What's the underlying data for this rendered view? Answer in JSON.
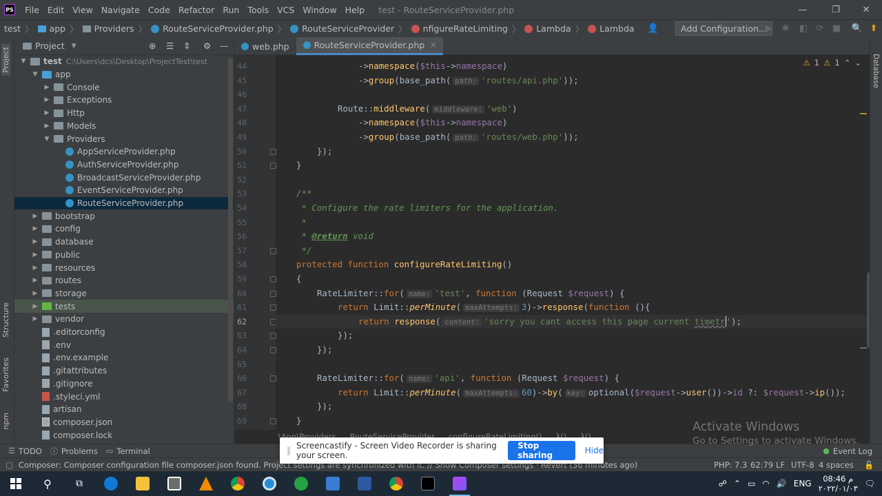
{
  "menubar": {
    "logo": "PS",
    "items": [
      "File",
      "Edit",
      "View",
      "Navigate",
      "Code",
      "Refactor",
      "Run",
      "Tools",
      "VCS",
      "Window",
      "Help"
    ],
    "title": "test - RouteServiceProvider.php"
  },
  "navbar": {
    "crumbs": [
      "test",
      "app",
      "Providers",
      "RouteServiceProvider.php",
      "RouteServiceProvider",
      "nfigureRateLimiting",
      "Lambda",
      "Lambda"
    ],
    "add_configuration": "Add Configuration..."
  },
  "left_strip": {
    "labels": [
      "Project",
      "Structure",
      "Favorites",
      "npm"
    ]
  },
  "project_panel": {
    "title": "Project",
    "tree": [
      {
        "label": "test",
        "path": "C:\\Users\\dcs\\Desktop\\ProjectTest\\test",
        "level": 0,
        "kind": "folder",
        "open": true
      },
      {
        "label": "app",
        "level": 1,
        "kind": "folder-blue",
        "open": true
      },
      {
        "label": "Console",
        "level": 2,
        "kind": "folder",
        "open": false
      },
      {
        "label": "Exceptions",
        "level": 2,
        "kind": "folder",
        "open": false
      },
      {
        "label": "Http",
        "level": 2,
        "kind": "folder",
        "open": false
      },
      {
        "label": "Models",
        "level": 2,
        "kind": "folder",
        "open": false
      },
      {
        "label": "Providers",
        "level": 2,
        "kind": "folder",
        "open": true
      },
      {
        "label": "AppServiceProvider.php",
        "level": 3,
        "kind": "php"
      },
      {
        "label": "AuthServiceProvider.php",
        "level": 3,
        "kind": "php"
      },
      {
        "label": "BroadcastServiceProvider.php",
        "level": 3,
        "kind": "php"
      },
      {
        "label": "EventServiceProvider.php",
        "level": 3,
        "kind": "php"
      },
      {
        "label": "RouteServiceProvider.php",
        "level": 3,
        "kind": "php",
        "selected": true
      },
      {
        "label": "bootstrap",
        "level": 1,
        "kind": "folder",
        "open": false
      },
      {
        "label": "config",
        "level": 1,
        "kind": "folder",
        "open": false
      },
      {
        "label": "database",
        "level": 1,
        "kind": "folder",
        "open": false
      },
      {
        "label": "public",
        "level": 1,
        "kind": "folder",
        "open": false
      },
      {
        "label": "resources",
        "level": 1,
        "kind": "folder",
        "open": false
      },
      {
        "label": "routes",
        "level": 1,
        "kind": "folder",
        "open": false
      },
      {
        "label": "storage",
        "level": 1,
        "kind": "folder",
        "open": false
      },
      {
        "label": "tests",
        "level": 1,
        "kind": "folder-green",
        "open": false,
        "highlight": true
      },
      {
        "label": "vendor",
        "level": 1,
        "kind": "folder",
        "open": false
      },
      {
        "label": ".editorconfig",
        "level": 1,
        "kind": "file"
      },
      {
        "label": ".env",
        "level": 1,
        "kind": "file"
      },
      {
        "label": ".env.example",
        "level": 1,
        "kind": "file"
      },
      {
        "label": ".gitattributes",
        "level": 1,
        "kind": "file"
      },
      {
        "label": ".gitignore",
        "level": 1,
        "kind": "file"
      },
      {
        "label": ".styleci.yml",
        "level": 1,
        "kind": "yml"
      },
      {
        "label": "artisan",
        "level": 1,
        "kind": "file"
      },
      {
        "label": "composer.json",
        "level": 1,
        "kind": "json"
      },
      {
        "label": "composer.lock",
        "level": 1,
        "kind": "file"
      }
    ]
  },
  "tabs": [
    {
      "label": "web.php",
      "active": false
    },
    {
      "label": "RouteServiceProvider.php",
      "active": true
    }
  ],
  "editor": {
    "warnings": {
      "a": "1",
      "b": "1"
    },
    "current_line": 62,
    "lines": [
      {
        "n": "44",
        "i": 4,
        "t": [
          [
            "->",
            ""
          ],
          [
            "namespace",
            "fn"
          ],
          [
            "(",
            ""
          ],
          [
            "$this",
            "vr"
          ],
          [
            "->",
            ""
          ],
          [
            "namespace",
            "mt"
          ],
          [
            ")",
            ""
          ]
        ]
      },
      {
        "n": "45",
        "i": 4,
        "t": [
          [
            "->",
            ""
          ],
          [
            "group",
            "fn"
          ],
          [
            "(base_path(",
            ""
          ],
          [
            "path:",
            "hint"
          ],
          [
            "'routes/api.php'",
            "st"
          ],
          [
            "));",
            ""
          ]
        ]
      },
      {
        "n": "46",
        "i": 0,
        "t": []
      },
      {
        "n": "47",
        "i": 3,
        "t": [
          [
            "Route::",
            ""
          ],
          [
            "middleware",
            "fn"
          ],
          [
            "(",
            ""
          ],
          [
            "middleware:",
            "hint"
          ],
          [
            "'web'",
            "st"
          ],
          [
            ")",
            ""
          ]
        ]
      },
      {
        "n": "48",
        "i": 4,
        "t": [
          [
            "->",
            ""
          ],
          [
            "namespace",
            "fn"
          ],
          [
            "(",
            ""
          ],
          [
            "$this",
            "vr"
          ],
          [
            "->",
            ""
          ],
          [
            "namespace",
            "mt"
          ],
          [
            ")",
            ""
          ]
        ]
      },
      {
        "n": "49",
        "i": 4,
        "t": [
          [
            "->",
            ""
          ],
          [
            "group",
            "fn"
          ],
          [
            "(base_path(",
            ""
          ],
          [
            "path:",
            "hint"
          ],
          [
            "'routes/web.php'",
            "st"
          ],
          [
            "));",
            ""
          ]
        ]
      },
      {
        "n": "50",
        "i": 2,
        "t": [
          [
            "});",
            ""
          ]
        ]
      },
      {
        "n": "51",
        "i": 1,
        "t": [
          [
            "}",
            ""
          ]
        ]
      },
      {
        "n": "52",
        "i": 0,
        "t": []
      },
      {
        "n": "53",
        "i": 1,
        "t": [
          [
            "/**",
            "cm"
          ]
        ]
      },
      {
        "n": "54",
        "i": 1,
        "t": [
          [
            " * Configure the rate limiters for the application.",
            "cm"
          ]
        ]
      },
      {
        "n": "55",
        "i": 1,
        "t": [
          [
            " *",
            "cm"
          ]
        ]
      },
      {
        "n": "56",
        "i": 1,
        "t": [
          [
            " * ",
            "cm"
          ],
          [
            "@return",
            "tg"
          ],
          [
            " void",
            "cm"
          ]
        ]
      },
      {
        "n": "57",
        "i": 1,
        "t": [
          [
            " */",
            "cm"
          ]
        ]
      },
      {
        "n": "58",
        "i": 1,
        "t": [
          [
            "protected ",
            "kw"
          ],
          [
            "function ",
            "kw"
          ],
          [
            "configureRateLimiting",
            "fn"
          ],
          [
            "()",
            ""
          ]
        ]
      },
      {
        "n": "59",
        "i": 1,
        "t": [
          [
            "{",
            ""
          ]
        ]
      },
      {
        "n": "60",
        "i": 2,
        "t": [
          [
            "RateLimiter::",
            ""
          ],
          [
            "for",
            "kw"
          ],
          [
            "(",
            ""
          ],
          [
            "name:",
            "hint"
          ],
          [
            "'test'",
            "st"
          ],
          [
            ", ",
            ""
          ],
          [
            "function ",
            "kw"
          ],
          [
            "(Request ",
            ""
          ],
          [
            "$request",
            "vr"
          ],
          [
            ") {",
            ""
          ]
        ]
      },
      {
        "n": "61",
        "i": 3,
        "t": [
          [
            "return ",
            "kw"
          ],
          [
            "Limit::",
            ""
          ],
          [
            "perMinute",
            "fni"
          ],
          [
            "(",
            ""
          ],
          [
            "maxAttempts:",
            "hint"
          ],
          [
            "3",
            "nm"
          ],
          [
            ")->",
            ""
          ],
          [
            "response",
            "fn"
          ],
          [
            "(",
            ""
          ],
          [
            "function ",
            "kw"
          ],
          [
            "(){",
            ""
          ]
        ]
      },
      {
        "n": "62",
        "i": 4,
        "t": [
          [
            "return ",
            "kw"
          ],
          [
            "response",
            "fn"
          ],
          [
            "(",
            ""
          ],
          [
            "content:",
            "hint"
          ],
          [
            "'sorry you cant access this page current ",
            "st"
          ],
          [
            "timetr",
            "stw"
          ],
          [
            "'",
            "st"
          ],
          [
            ");",
            ""
          ]
        ]
      },
      {
        "n": "63",
        "i": 3,
        "t": [
          [
            "});",
            ""
          ]
        ]
      },
      {
        "n": "64",
        "i": 2,
        "t": [
          [
            "});",
            ""
          ]
        ]
      },
      {
        "n": "65",
        "i": 0,
        "t": []
      },
      {
        "n": "66",
        "i": 2,
        "t": [
          [
            "RateLimiter::",
            ""
          ],
          [
            "for",
            "kw"
          ],
          [
            "(",
            ""
          ],
          [
            "name:",
            "hint"
          ],
          [
            "'api'",
            "st"
          ],
          [
            ", ",
            ""
          ],
          [
            "function ",
            "kw"
          ],
          [
            "(Request ",
            ""
          ],
          [
            "$request",
            "vr"
          ],
          [
            ") {",
            ""
          ]
        ]
      },
      {
        "n": "67",
        "i": 3,
        "t": [
          [
            "return ",
            "kw"
          ],
          [
            "Limit::",
            ""
          ],
          [
            "perMinute",
            "fni"
          ],
          [
            "(",
            ""
          ],
          [
            "maxAttempts:",
            "hint"
          ],
          [
            "60",
            "nm"
          ],
          [
            ")->",
            ""
          ],
          [
            "by",
            "fn"
          ],
          [
            "(",
            ""
          ],
          [
            "key:",
            "hint"
          ],
          [
            "optional(",
            ""
          ],
          [
            "$request",
            "vr"
          ],
          [
            "->",
            ""
          ],
          [
            "user",
            "fn"
          ],
          [
            "())->",
            ""
          ],
          [
            "id",
            "mt"
          ],
          [
            " ?: ",
            ""
          ],
          [
            "$request",
            "vr"
          ],
          [
            "->",
            ""
          ],
          [
            "ip",
            "fn"
          ],
          [
            "());",
            ""
          ]
        ]
      },
      {
        "n": "68",
        "i": 2,
        "t": [
          [
            "});",
            ""
          ]
        ]
      },
      {
        "n": "69",
        "i": 1,
        "t": [
          [
            "}",
            ""
          ]
        ]
      }
    ]
  },
  "code_breadcrumb": [
    "\\App\\Providers",
    "RouteServiceProvider",
    "configureRateLimiting()",
    "λ()",
    "λ()"
  ],
  "tool_strip": {
    "todo": "TODO",
    "problems": "Problems",
    "terminal": "Terminal",
    "event_log": "Event Log"
  },
  "statusbar": {
    "message": "Composer: Composer configuration file composer.json found. Project settings are synchronized with it. // Show Composer settings · Revert (36 minutes ago)",
    "php": "PHP: 7.3",
    "pos": "62:79",
    "lf": "LF",
    "enc": "UTF-8",
    "indent": "4 spaces"
  },
  "right_strip": {
    "label": "Database"
  },
  "watermark": {
    "line1": "Activate Windows",
    "line2": "Go to Settings to activate Windows."
  },
  "sharebar": {
    "text": "Screencastify - Screen Video Recorder is sharing your screen.",
    "stop": "Stop sharing",
    "hide": "Hide"
  },
  "taskbar": {
    "lang": "ENG",
    "time": "08:46 م",
    "date": "٢٠٢٢/٠١/٠٣"
  }
}
